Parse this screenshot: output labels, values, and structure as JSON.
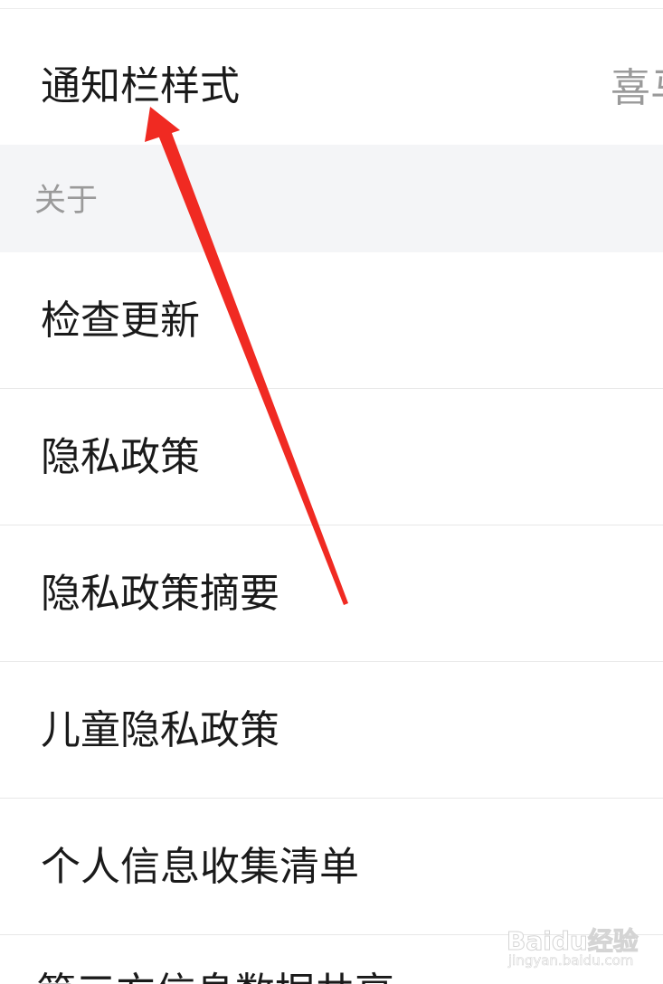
{
  "settings": {
    "notification_style": {
      "label": "通知栏样式",
      "value": "喜马"
    },
    "about_section": {
      "title": "关于"
    },
    "items": [
      {
        "label": "检查更新"
      },
      {
        "label": "隐私政策"
      },
      {
        "label": "隐私政策摘要"
      },
      {
        "label": "儿童隐私政策"
      },
      {
        "label": "个人信息收集清单"
      },
      {
        "label": "第三方信息数据共享"
      }
    ]
  },
  "annotation": {
    "arrow_color": "#f02a22"
  },
  "watermark": {
    "main": "Baidu经验",
    "sub": "jingyan.baidu.com"
  }
}
